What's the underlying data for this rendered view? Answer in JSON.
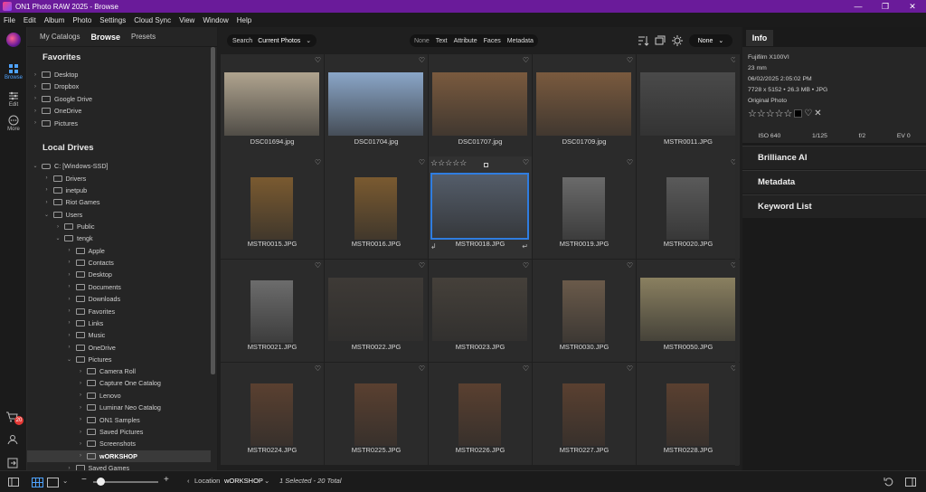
{
  "window": {
    "title": "ON1 Photo RAW 2025 - Browse",
    "buttons": [
      "—",
      "❐",
      "✕"
    ]
  },
  "menu": [
    "File",
    "Edit",
    "Album",
    "Photo",
    "Settings",
    "Cloud Sync",
    "View",
    "Window",
    "Help"
  ],
  "rail": {
    "tools": [
      "Browse",
      "Edit",
      "More"
    ],
    "cart_badge": "20"
  },
  "left_panel": {
    "tabs": [
      "My Catalogs",
      "Browse",
      "Presets"
    ],
    "favorites_title": "Favorites",
    "favorites": [
      "Desktop",
      "Dropbox",
      "Google Drive",
      "OneDrive",
      "Pictures"
    ],
    "local_drives_title": "Local Drives",
    "drive": "C: [Windows-SSD]",
    "drive_children": [
      "Drivers",
      "inetpub",
      "Riot Games",
      "Users"
    ],
    "users_children": [
      "Public",
      "tengk"
    ],
    "tengk_children": [
      "Apple",
      "Contacts",
      "Desktop",
      "Documents",
      "Downloads",
      "Favorites",
      "Links",
      "Music",
      "OneDrive",
      "Pictures"
    ],
    "pictures_children": [
      "Camera Roll",
      "Capture One Catalog",
      "Lenovo",
      "Luminar Neo Catalog",
      "ON1 Samples",
      "Saved Pictures",
      "Screenshots",
      "wORKSHOP"
    ],
    "after_pictures": [
      "Saved Games"
    ]
  },
  "toolbar": {
    "search_label": "Search",
    "search_scope": "Current Photos",
    "filters": [
      "None",
      "Text",
      "Attribute",
      "Faces",
      "Metadata"
    ],
    "sort": "None"
  },
  "photos": [
    {
      "name": "DSC01694.jpg",
      "orient": "land",
      "tone": "#b0a48f"
    },
    {
      "name": "DSC01704.jpg",
      "orient": "land",
      "tone": "#8aa6c8"
    },
    {
      "name": "DSC01707.jpg",
      "orient": "land",
      "tone": "#7a5a3e"
    },
    {
      "name": "DSC01709.jpg",
      "orient": "land",
      "tone": "#7a5a3e"
    },
    {
      "name": "MSTR0011.JPG",
      "orient": "land",
      "tone": "#4a4a4a"
    },
    {
      "name": "MSTR0015.JPG",
      "orient": "port",
      "tone": "#7a5a30"
    },
    {
      "name": "MSTR0016.JPG",
      "orient": "port",
      "tone": "#7a5a30"
    },
    {
      "name": "MSTR0018.JPG",
      "orient": "land",
      "tone": "#545d6a",
      "selected": true
    },
    {
      "name": "MSTR0019.JPG",
      "orient": "port",
      "tone": "#6a6a6a"
    },
    {
      "name": "MSTR0020.JPG",
      "orient": "port",
      "tone": "#5a5a5a"
    },
    {
      "name": "MSTR0021.JPG",
      "orient": "port",
      "tone": "#6c6c6c"
    },
    {
      "name": "MSTR0022.JPG",
      "orient": "land",
      "tone": "#3e3a36"
    },
    {
      "name": "MSTR0023.JPG",
      "orient": "land",
      "tone": "#45403a"
    },
    {
      "name": "MSTR0030.JPG",
      "orient": "port",
      "tone": "#6a5a4a"
    },
    {
      "name": "MSTR0050.JPG",
      "orient": "land",
      "tone": "#8a8060"
    },
    {
      "name": "MSTR0224.JPG",
      "orient": "port",
      "tone": "#5a4030"
    },
    {
      "name": "MSTR0225.JPG",
      "orient": "port",
      "tone": "#5a4030"
    },
    {
      "name": "MSTR0226.JPG",
      "orient": "port",
      "tone": "#5a4030"
    },
    {
      "name": "MSTR0227.JPG",
      "orient": "port",
      "tone": "#5a4030"
    },
    {
      "name": "MSTR0228.JPG",
      "orient": "port",
      "tone": "#5a4030"
    }
  ],
  "selected_stars": "☆☆☆☆☆",
  "info": {
    "tab": "Info",
    "camera": "Fujifilm X100VI",
    "focal": "23 mm",
    "date": "06/02/2025 2:05:02 PM",
    "dims": "7728 x 5152 • 26.3 MB • JPG",
    "type": "Original Photo",
    "rating": "☆☆☆☆☆",
    "exif": [
      "ISO 640",
      "1/125",
      "f/2",
      "EV 0"
    ],
    "sections": [
      "Brilliance AI",
      "Metadata",
      "Keyword List"
    ]
  },
  "bottom": {
    "location_label": "Location",
    "location": "wORKSHOP",
    "status": "1 Selected - 20 Total"
  },
  "colors": {
    "titlebar": "#6a1b9a",
    "accent": "#2f7de0",
    "badge": "#e53935"
  }
}
